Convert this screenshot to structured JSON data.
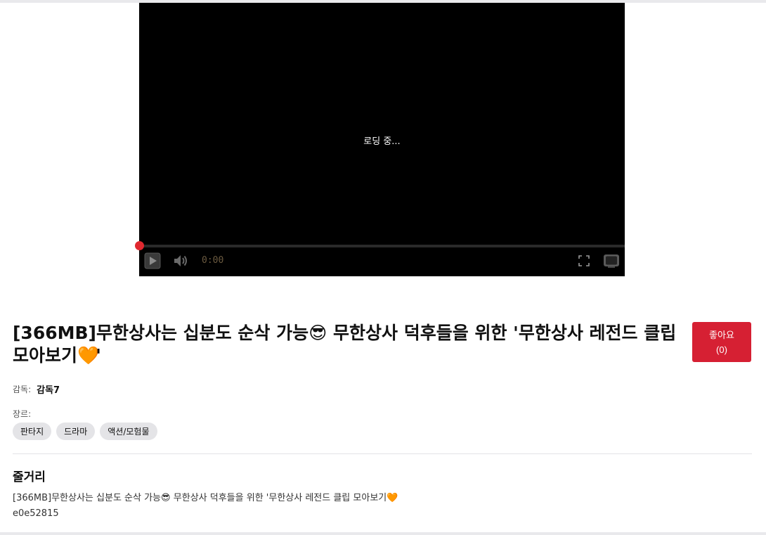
{
  "player": {
    "loading_text": "로딩 중...",
    "time": "0:00",
    "icons": {
      "play": "play-icon",
      "volume": "volume-icon",
      "fullscreen": "fullscreen-icon",
      "tv": "tv-icon"
    },
    "progress": 0,
    "accent_color": "#e0282f"
  },
  "video": {
    "title_main": "[366MB]무한상사는 십분도 순삭 가능",
    "title_emoji_1": "😎",
    "title_middle": " 무한상사 덕후들을 위한 '무한상사 레전드 클립 모아보기",
    "title_emoji_2": "🧡",
    "title_end": "'",
    "like_label": "좋아요",
    "like_count": "(0)",
    "like_color": "#d62033"
  },
  "meta": {
    "director_label": "감독:",
    "director_name": "감독7",
    "genre_label": "장르:",
    "genres": [
      "판타지",
      "드라마",
      "액션/모험물"
    ]
  },
  "synopsis": {
    "heading": "줄거리",
    "text_main": "[366MB]무한상사는 십분도 순삭 가능",
    "text_emoji_1": "😎",
    "text_middle": " 무한상사 덕후들을 위한 '무한상사 레전드 클립 모아보기",
    "text_emoji_2": "🧡",
    "code": "e0e52815"
  }
}
